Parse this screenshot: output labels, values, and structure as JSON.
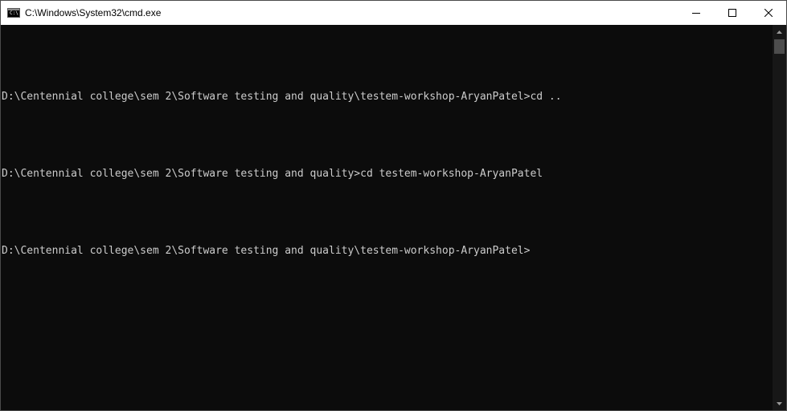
{
  "window": {
    "title": "C:\\Windows\\System32\\cmd.exe",
    "icon_label": "C:\\"
  },
  "controls": {
    "minimize_icon": "minimize-icon",
    "maximize_icon": "maximize-icon",
    "close_icon": "close-icon"
  },
  "console": {
    "lines": [
      "D:\\Centennial college\\sem 2\\Software testing and quality\\testem-workshop-AryanPatel>cd ..",
      "D:\\Centennial college\\sem 2\\Software testing and quality>cd testem-workshop-AryanPatel",
      "D:\\Centennial college\\sem 2\\Software testing and quality\\testem-workshop-AryanPatel>"
    ]
  },
  "colors": {
    "background": "#0c0c0c",
    "text": "#cccccc",
    "titlebar": "#ffffff"
  }
}
